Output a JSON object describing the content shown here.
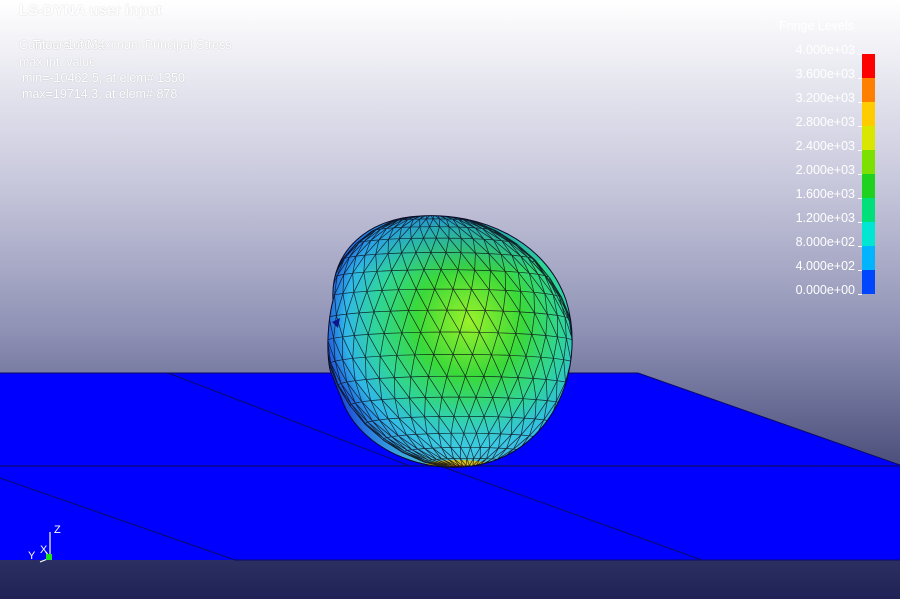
{
  "window": {
    "title": "LS-DYNA user input"
  },
  "hud": {
    "time_label": "Time =",
    "time_value": "1.0664",
    "contour_label": "Contours of Maximum Principal Stress",
    "max_ipt": "max ipt. value",
    "min_line": "min=-10462.5, at elem# 1350",
    "max_line": "max=19714.3, at elem# 878"
  },
  "fringe": {
    "title": "Fringe Levels",
    "labels": [
      "4.000e+03",
      "3.600e+03",
      "3.200e+03",
      "2.800e+03",
      "2.400e+03",
      "2.000e+03",
      "1.600e+03",
      "1.200e+03",
      "8.000e+02",
      "4.000e+02",
      "0.000e+00"
    ],
    "colors": [
      "#ff0000",
      "#ff7f00",
      "#ffcc00",
      "#d8e600",
      "#7ce000",
      "#1fd21f",
      "#00e07a",
      "#00e6d2",
      "#00b4ff",
      "#0046ff"
    ]
  },
  "triad": {
    "z": "Z",
    "y": "Y",
    "x": "X"
  },
  "colors": {
    "floor": "#0000ff",
    "floor_edge": "#0a0a6a",
    "sphere_top": "#1a2ad8",
    "sphere_mid": "#3ad93a",
    "sphere_low": "#35c4e6",
    "mesh": "#0a0a14"
  }
}
